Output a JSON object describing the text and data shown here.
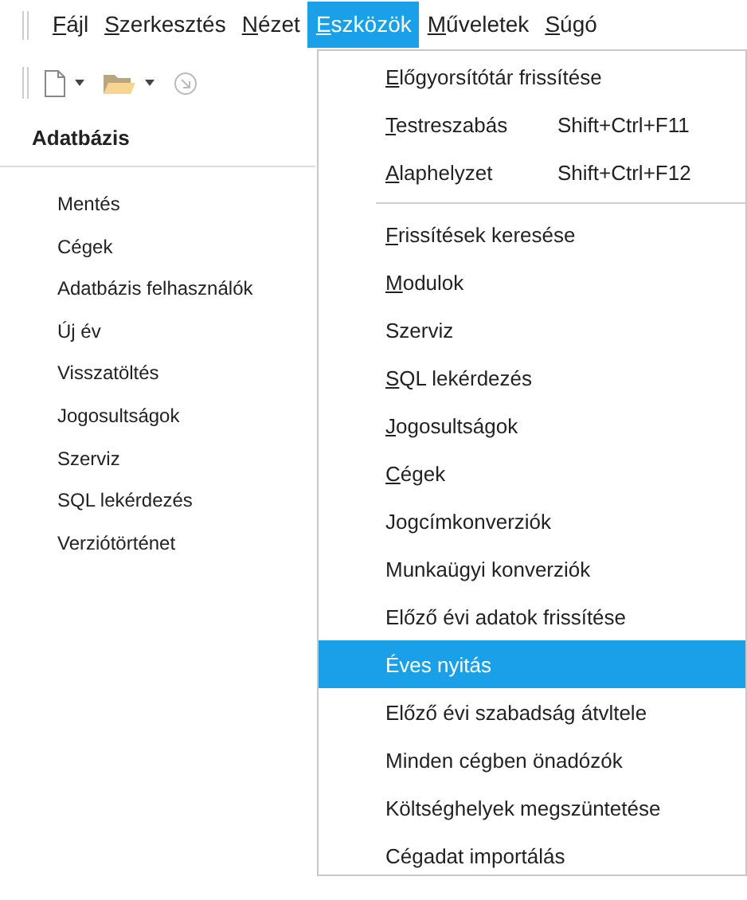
{
  "menubar": [
    {
      "key": "F",
      "label": "ájl",
      "selected": false
    },
    {
      "key": "S",
      "label": "zerkesztés",
      "selected": false
    },
    {
      "key": "N",
      "label": "ézet",
      "selected": false
    },
    {
      "key": "E",
      "label": "szközök",
      "selected": true
    },
    {
      "key": "M",
      "label": "űveletek",
      "selected": false
    },
    {
      "key": "S",
      "label": "úgó",
      "selected": false
    }
  ],
  "toolbar": {
    "buttons": [
      {
        "kind": "new"
      },
      {
        "kind": "caret"
      },
      {
        "kind": "open"
      },
      {
        "kind": "caret"
      },
      {
        "kind": "go"
      }
    ]
  },
  "panel": {
    "title": "Adatbázis",
    "items": [
      "Mentés",
      "Cégek",
      "Adatbázis felhasználók",
      "Új év",
      "Visszatöltés",
      "Jogosultságok",
      "Szerviz",
      "SQL lekérdezés",
      "Verziótörténet"
    ]
  },
  "menu": [
    {
      "kind": "item",
      "key": "E",
      "label": "lőgyorsítótár frissítése",
      "selected": false
    },
    {
      "kind": "item",
      "key": "T",
      "label": "estreszabás",
      "shortcut": "Shift+Ctrl+F11",
      "selected": false
    },
    {
      "kind": "item",
      "key": "A",
      "label": "laphelyzet",
      "shortcut": "Shift+Ctrl+F12",
      "selected": false
    },
    {
      "kind": "separator"
    },
    {
      "kind": "item",
      "key": "F",
      "label": "rissítések keresése",
      "selected": false
    },
    {
      "kind": "item",
      "key": "M",
      "label": "odulok",
      "selected": false
    },
    {
      "kind": "item",
      "label": "Szerviz",
      "selected": false
    },
    {
      "kind": "item",
      "key": "S",
      "label": "QL lekérdezés",
      "selected": false
    },
    {
      "kind": "item",
      "key": "J",
      "label": "ogosultságok",
      "selected": false
    },
    {
      "kind": "item",
      "key": "C",
      "label": "égek",
      "selected": false
    },
    {
      "kind": "item",
      "label": "Jogcímkonverziók",
      "selected": false
    },
    {
      "kind": "item",
      "label": "Munkaügyi konverziók",
      "selected": false
    },
    {
      "kind": "item",
      "label": "Előző évi adatok frissítése",
      "selected": false
    },
    {
      "kind": "item",
      "label": "Éves nyitás",
      "selected": true
    },
    {
      "kind": "item",
      "label": "Előző évi szabadság átvltele",
      "selected": false
    },
    {
      "kind": "item",
      "label": "Minden cégben önadózók",
      "selected": false
    },
    {
      "kind": "item",
      "label": "Költséghelyek megszüntetése",
      "selected": false
    },
    {
      "kind": "item",
      "label": "Cégadat importálás",
      "selected": false
    }
  ]
}
